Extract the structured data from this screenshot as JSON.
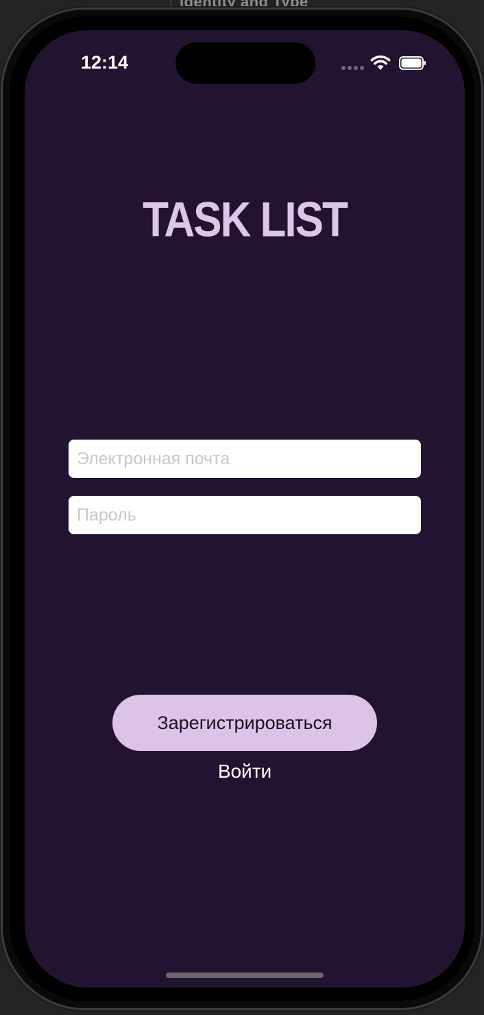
{
  "backdrop": {
    "title": "Identity and Type"
  },
  "status_bar": {
    "time": "12:14"
  },
  "app": {
    "title": "TASK LIST"
  },
  "form": {
    "email_placeholder": "Электронная почта",
    "email_value": "",
    "password_placeholder": "Пароль",
    "password_value": ""
  },
  "actions": {
    "register_label": "Зарегистрироваться",
    "login_label": "Войти"
  },
  "colors": {
    "background": "#221430",
    "accent": "#dcc4e8",
    "title": "#dcc6ea"
  }
}
